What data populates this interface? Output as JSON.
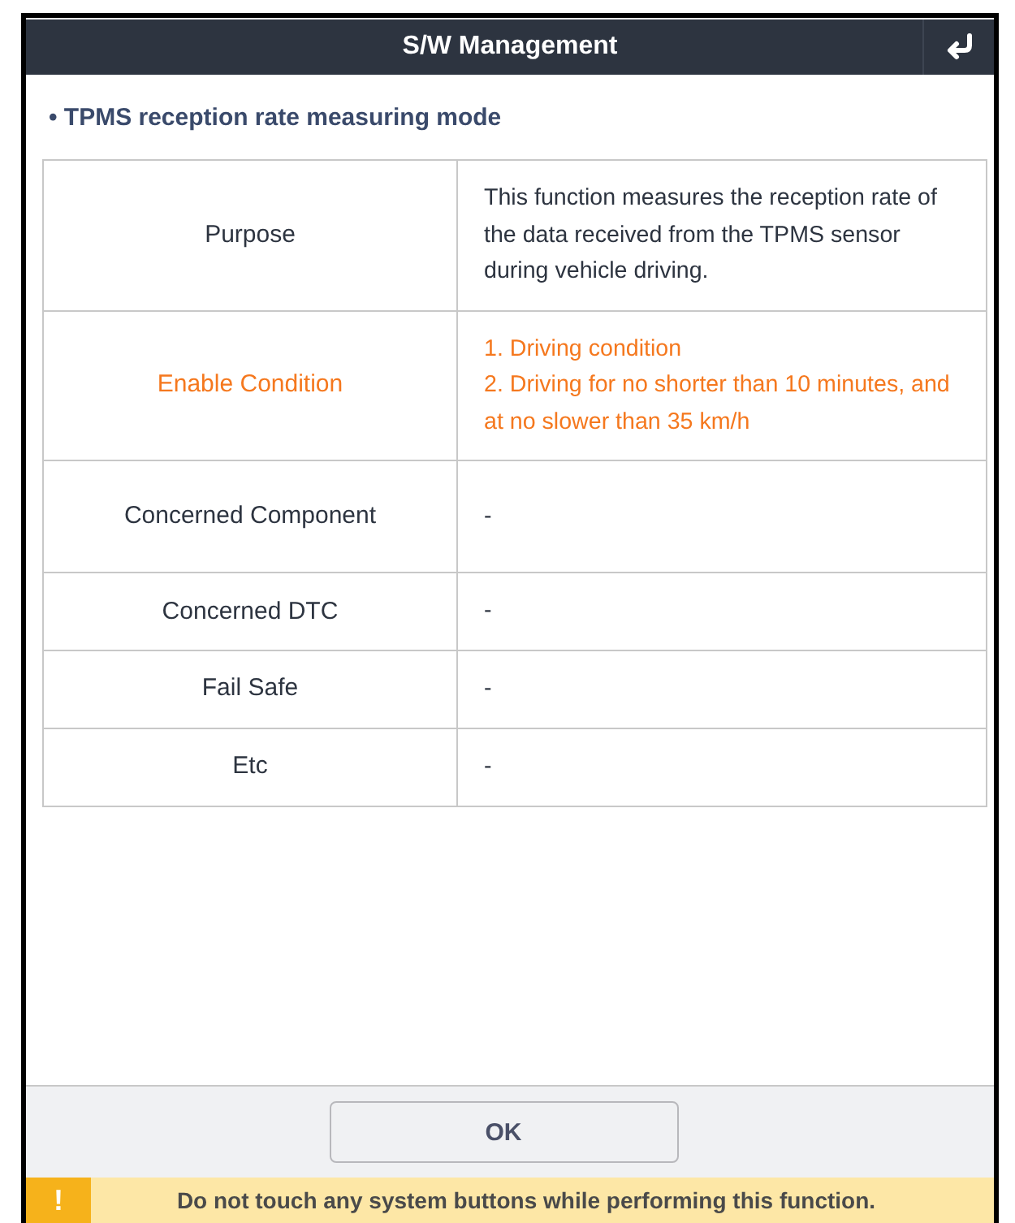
{
  "window": {
    "title": "S/W Management"
  },
  "section_title": "• TPMS reception rate measuring mode",
  "rows": [
    {
      "label": "Purpose",
      "highlighted": false,
      "lines": [
        "This function measures the reception rate of the data received from the TPMS sensor during vehicle driving."
      ]
    },
    {
      "label": "Enable Condition",
      "highlighted": true,
      "lines": [
        "1. Driving condition",
        "2. Driving for no shorter than 10 minutes, and at no slower than 35 km/h"
      ]
    },
    {
      "label": "Concerned Component",
      "highlighted": false,
      "lines": [
        "-"
      ]
    },
    {
      "label": "Concerned DTC",
      "highlighted": false,
      "lines": [
        "-"
      ]
    },
    {
      "label": "Fail Safe",
      "highlighted": false,
      "lines": [
        "-"
      ]
    },
    {
      "label": "Etc",
      "highlighted": false,
      "lines": [
        "-"
      ]
    }
  ],
  "buttons": [
    "OK"
  ],
  "warning": {
    "icon": "!",
    "text": "Do not touch any system buttons while performing this function."
  }
}
